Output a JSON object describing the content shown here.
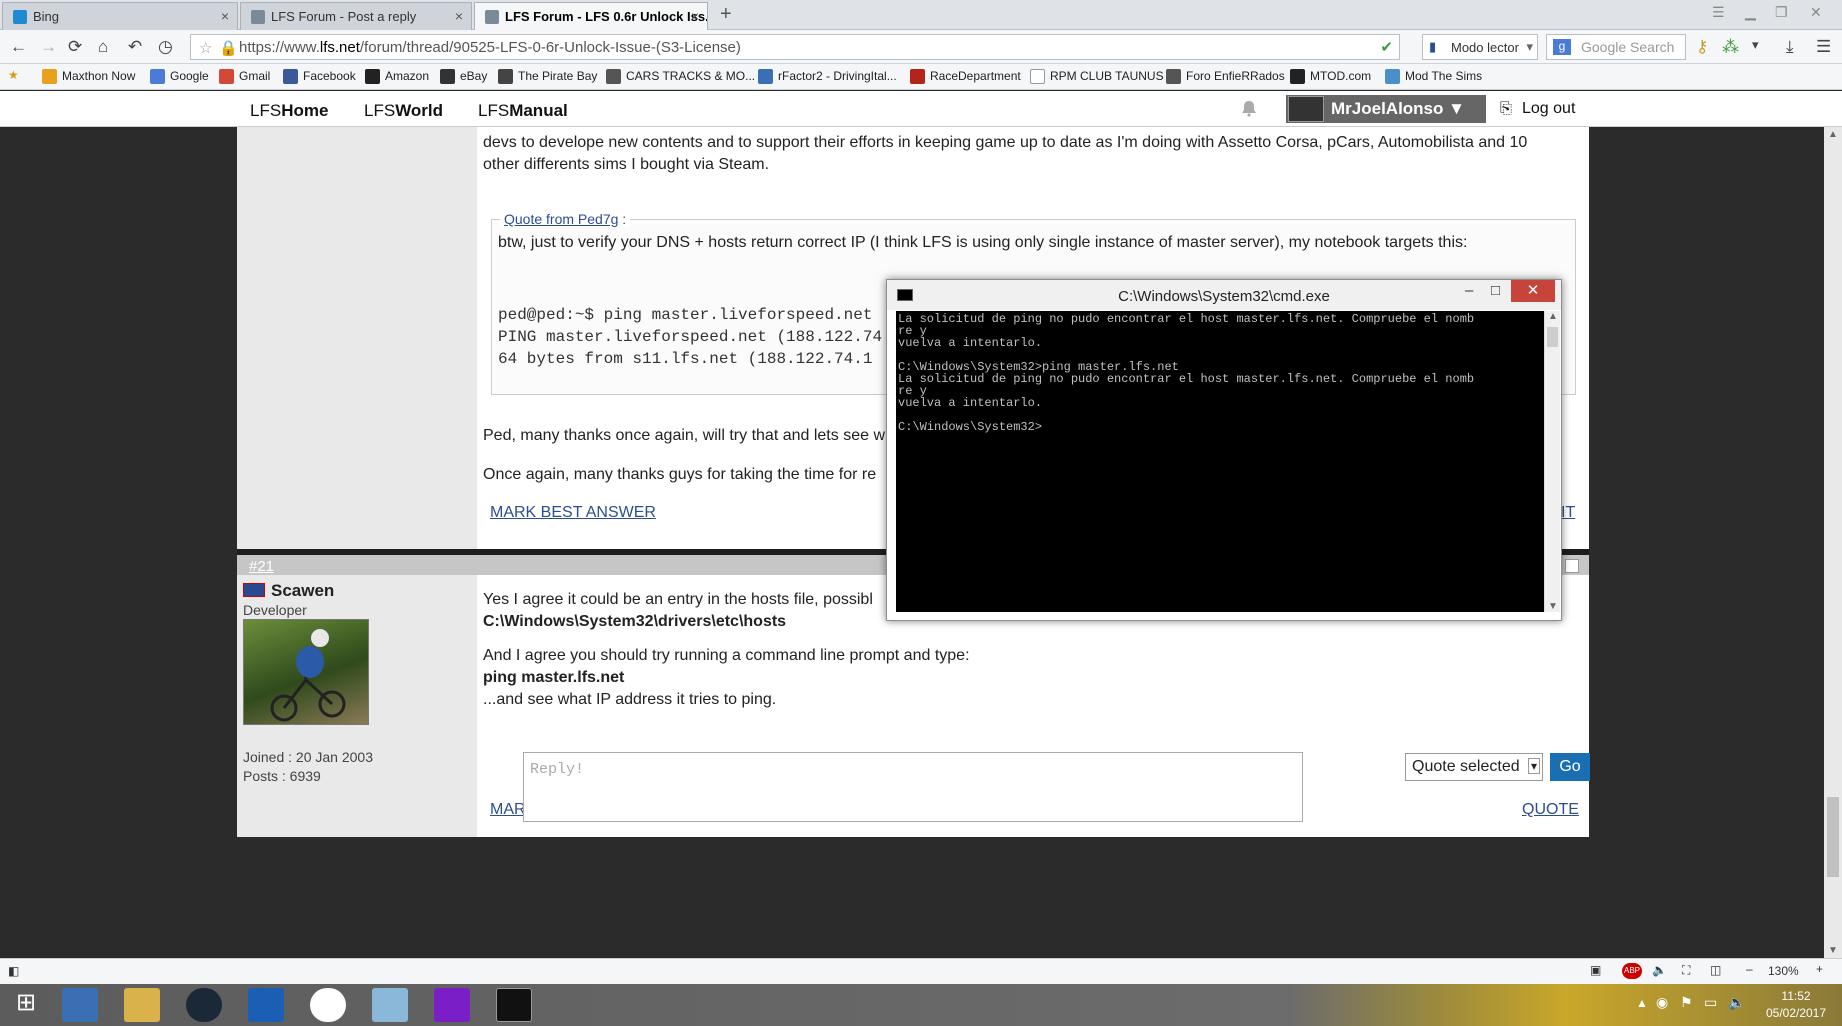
{
  "browser": {
    "tabs": [
      {
        "label": "Bing",
        "active": false
      },
      {
        "label": "LFS Forum - Post a reply",
        "active": false
      },
      {
        "label": "LFS Forum - LFS 0.6r Unlock Iss...",
        "active": true
      }
    ],
    "url_prefix": "https://www.",
    "url_domain": "lfs.net",
    "url_path": "/forum/thread/90525-LFS-0-6r-Unlock-Issue-(S3-License)",
    "reader_label": "Modo lector",
    "search_placeholder": "Google Search",
    "bookmarks": [
      "Maxthon Now",
      "Google",
      "Gmail",
      "Facebook",
      "Amazon",
      "eBay",
      "The Pirate Bay",
      "CARS TRACKS & MO...",
      "rFactor2 - DrivingItal...",
      "RaceDepartment",
      "RPM CLUB TAUNUS",
      "Foro EnfieRRados",
      "MTOD.com",
      "Mod The Sims"
    ],
    "zoom": "130%"
  },
  "site": {
    "nav": [
      {
        "pre": "LFS",
        "bold": "Home"
      },
      {
        "pre": "LFS",
        "bold": "World"
      },
      {
        "pre": "LFS",
        "bold": "Manual"
      }
    ],
    "username": "MrJoelAlonso ▼",
    "logout": "Log out"
  },
  "post1": {
    "text1": "devs to develope new contents and to support their efforts in keeping game up to date as I'm doing with Assetto Corsa, pCars, Automobilista and 10",
    "text2": "other differents sims I bought via Steam.",
    "quote_header": "Quote from Ped7g",
    "quote_colon": ":",
    "quote_text": "btw, just to verify your DNS + hosts return correct IP (I think LFS is using only single instance of master server), my notebook targets this:",
    "quote_code": [
      "ped@ped:~$ ping master.liveforspeed.net",
      "PING master.liveforspeed.net (188.122.74.1",
      "64 bytes from s11.lfs.net (188.122.74.1"
    ],
    "reply1": "Ped, many thanks once again, will try that and lets see w",
    "reply2": "Once again, many thanks guys for taking the time for re",
    "mark_best": "MARK BEST ANSWER",
    "edit_frag": "IT"
  },
  "post2": {
    "number": "#21",
    "author": "Scawen",
    "role": "Developer",
    "joined": "Joined : 20 Jan 2003",
    "posts": "Posts : 6939",
    "line1": "Yes I agree it could be an entry in the hosts file, possibl",
    "line2": "C:\\Windows\\System32\\drivers\\etc\\hosts",
    "line3": "And I agree you should try running a command line prompt and type:",
    "line4": "ping master.lfs.net",
    "line5": "...and see what IP address it tries to ping.",
    "mark_best": "MARK BEST ANSWER",
    "quote": "QUOTE"
  },
  "reply": {
    "placeholder": "Reply!",
    "quote_selected": "Quote selected",
    "go": "Go"
  },
  "cmd": {
    "title": "C:\\Windows\\System32\\cmd.exe",
    "lines": "La solicitud de ping no pudo encontrar el host master.lfs.net. Compruebe el nomb\nre y\nvuelva a intentarlo.\n\nC:\\Windows\\System32>ping master.lfs.net\nLa solicitud de ping no pudo encontrar el host master.lfs.net. Compruebe el nomb\nre y\nvuelva a intentarlo.\n\nC:\\Windows\\System32>"
  },
  "taskbar": {
    "time": "11:52",
    "date": "05/02/2017"
  }
}
